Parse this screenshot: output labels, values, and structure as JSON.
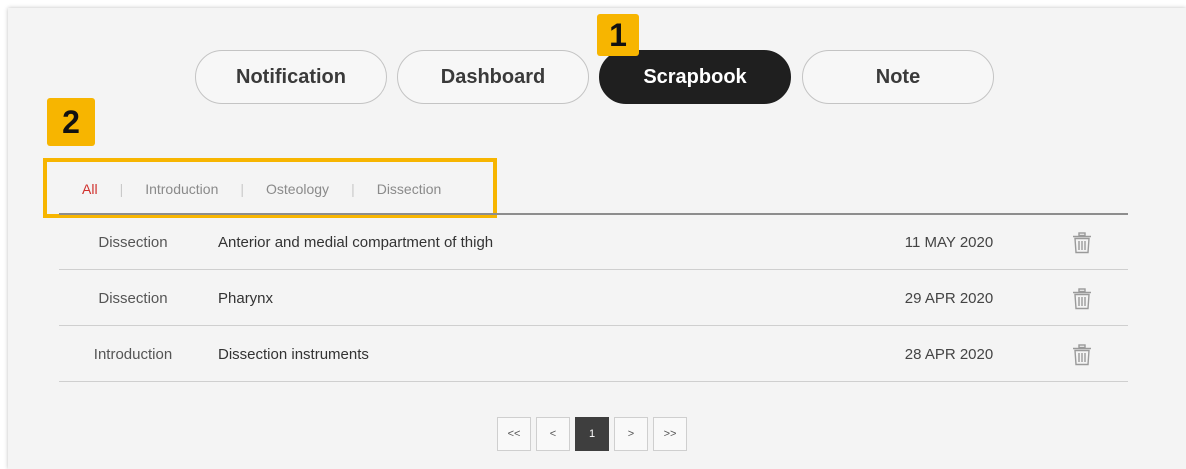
{
  "tabs": {
    "notification": "Notification",
    "dashboard": "Dashboard",
    "scrapbook": "Scrapbook",
    "note": "Note"
  },
  "callouts": {
    "one": "1",
    "two": "2"
  },
  "subtabs": [
    "All",
    "Introduction",
    "Osteology",
    "Dissection"
  ],
  "rows": [
    {
      "category": "Dissection",
      "title": "Anterior and medial compartment of thigh",
      "date": "11 MAY 2020"
    },
    {
      "category": "Dissection",
      "title": "Pharynx",
      "date": "29 APR 2020"
    },
    {
      "category": "Introduction",
      "title": "Dissection instruments",
      "date": "28 APR 2020"
    }
  ],
  "pagination": {
    "first": "<<",
    "prev": "<",
    "current": "1",
    "next": ">",
    "last": ">>"
  },
  "icons": {
    "delete": "trash-icon"
  },
  "colors": {
    "accent_callout": "#f7b500",
    "active_subtab": "#d0312d",
    "active_tab": "#1f1f1f"
  }
}
